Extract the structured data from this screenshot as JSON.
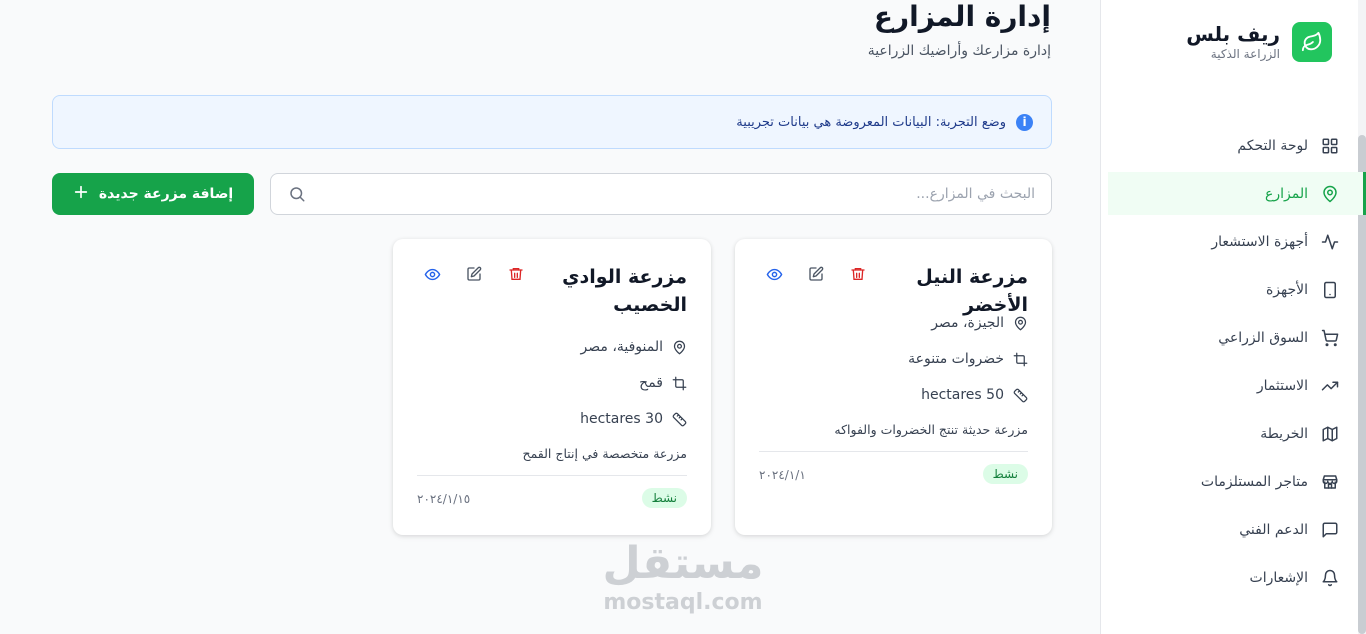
{
  "sidebar": {
    "brand_name": "ريف بلس",
    "brand_sub": "الزراعة الذكية",
    "items": [
      {
        "label": "لوحة التحكم",
        "icon": "dashboard-icon"
      },
      {
        "label": "المزارع",
        "icon": "map-pin-icon",
        "active": true
      },
      {
        "label": "أجهزة الاستشعار",
        "icon": "activity-icon"
      },
      {
        "label": "الأجهزة",
        "icon": "tablet-icon"
      },
      {
        "label": "السوق الزراعي",
        "icon": "cart-icon"
      },
      {
        "label": "الاستثمار",
        "icon": "trending-up-icon"
      },
      {
        "label": "الخريطة",
        "icon": "map-icon"
      },
      {
        "label": "متاجر المستلزمات",
        "icon": "store-icon"
      },
      {
        "label": "الدعم الفني",
        "icon": "chat-icon"
      },
      {
        "label": "الإشعارات",
        "icon": "bell-icon"
      }
    ]
  },
  "page": {
    "title": "إدارة المزارع",
    "subtitle": "إدارة مزارعك وأراضيك الزراعية",
    "demo_notice": "وضع التجربة: البيانات المعروضة هي بيانات تجريبية",
    "search_placeholder": "البحث في المزارع...",
    "add_button": "إضافة مزرعة جديدة"
  },
  "farms": [
    {
      "name": "مزرعة النيل الأخضر",
      "location": "الجيزة، مصر",
      "crop": "خضروات متنوعة",
      "area": "50 hectares",
      "description": "مزرعة حديثة تنتج الخضروات والفواكه",
      "status": "نشط",
      "date": "٢٠٢٤/١/١"
    },
    {
      "name": "مزرعة الوادي الخصيب",
      "location": "المنوفية، مصر",
      "crop": "قمح",
      "area": "30 hectares",
      "description": "مزرعة متخصصة في إنتاج القمح",
      "status": "نشط",
      "date": "٢٠٢٤/١/١٥"
    }
  ],
  "watermark": {
    "ar": "مستقل",
    "en": "mostaql.com"
  },
  "colors": {
    "accent": "#16a34a",
    "banner_bg": "#eff6ff",
    "badge_bg": "#dcfce7",
    "delete": "#dc2626",
    "view": "#2563eb"
  }
}
